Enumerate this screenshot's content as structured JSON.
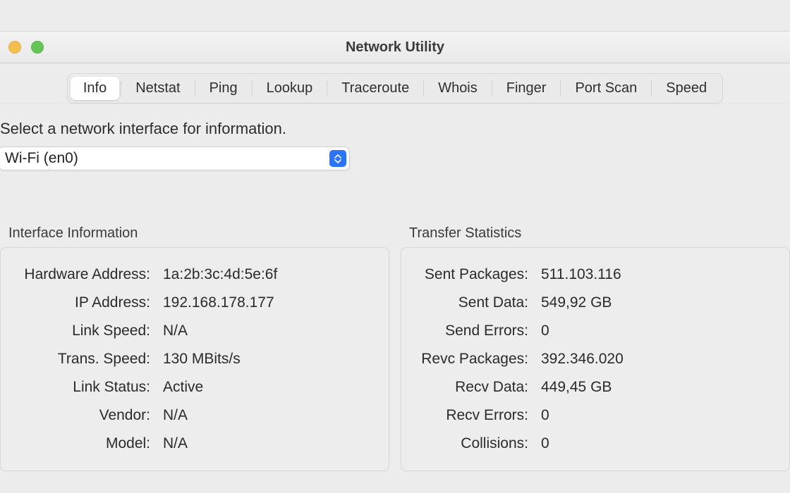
{
  "window": {
    "title": "Network Utility"
  },
  "tabs": [
    {
      "label": "Info",
      "active": true
    },
    {
      "label": "Netstat",
      "active": false
    },
    {
      "label": "Ping",
      "active": false
    },
    {
      "label": "Lookup",
      "active": false
    },
    {
      "label": "Traceroute",
      "active": false
    },
    {
      "label": "Whois",
      "active": false
    },
    {
      "label": "Finger",
      "active": false
    },
    {
      "label": "Port Scan",
      "active": false
    },
    {
      "label": "Speed",
      "active": false
    }
  ],
  "instruction": "Select a network interface for information.",
  "interface_select": {
    "selected": "Wi-Fi (en0)"
  },
  "interface_info": {
    "title": "Interface Information",
    "rows": [
      {
        "label": "Hardware Address:",
        "value": "1a:2b:3c:4d:5e:6f"
      },
      {
        "label": "IP Address:",
        "value": "192.168.178.177"
      },
      {
        "label": "Link Speed:",
        "value": "N/A"
      },
      {
        "label": "Trans. Speed:",
        "value": "130 MBits/s"
      },
      {
        "label": "Link Status:",
        "value": "Active"
      },
      {
        "label": "Vendor:",
        "value": "N/A"
      },
      {
        "label": "Model:",
        "value": "N/A"
      }
    ]
  },
  "transfer_stats": {
    "title": "Transfer Statistics",
    "rows": [
      {
        "label": "Sent Packages:",
        "value": "511.103.116"
      },
      {
        "label": "Sent Data:",
        "value": "549,92 GB"
      },
      {
        "label": "Send Errors:",
        "value": "0"
      },
      {
        "label": "Revc Packages:",
        "value": "392.346.020"
      },
      {
        "label": "Recv Data:",
        "value": "449,45 GB"
      },
      {
        "label": "Recv Errors:",
        "value": "0"
      },
      {
        "label": "Collisions:",
        "value": "0"
      }
    ]
  }
}
